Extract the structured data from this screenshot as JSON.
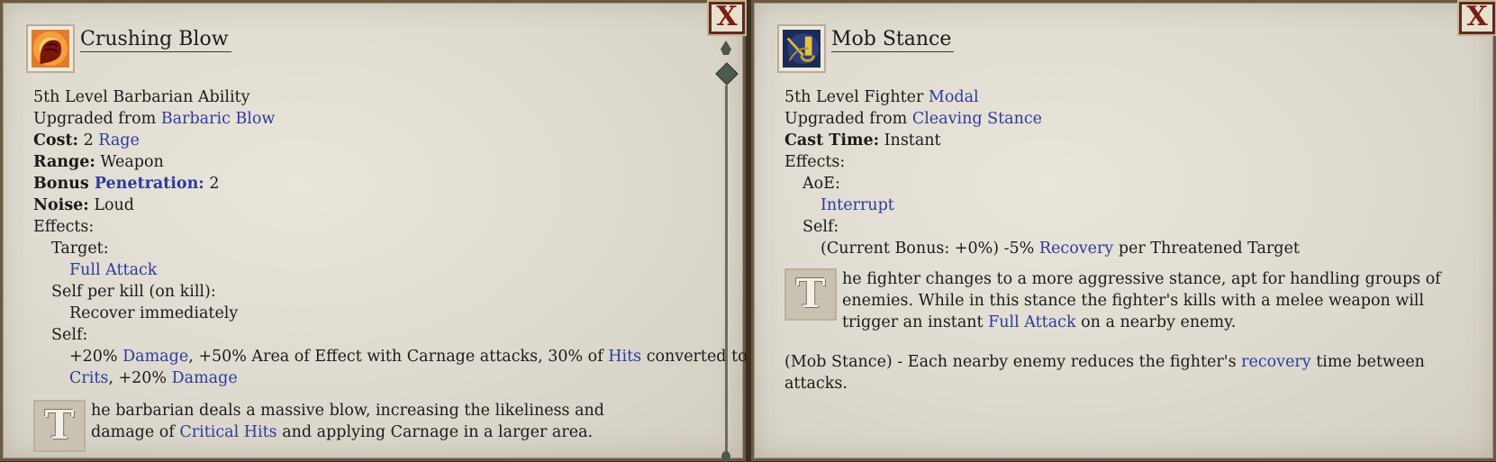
{
  "left": {
    "title": "Crushing Blow",
    "icon": "fist-icon",
    "level_line": "5th Level Barbarian Ability",
    "upgraded_prefix": "Upgraded from ",
    "upgraded_link": "Barbaric Blow",
    "cost_label": "Cost:",
    "cost_value": " 2 ",
    "cost_link": "Rage",
    "range_label": "Range:",
    "range_value": " Weapon",
    "bonus_label": "Bonus ",
    "bonus_link": "Penetration:",
    "bonus_value": " 2",
    "noise_label": "Noise:",
    "noise_value": " Loud",
    "effects_label": "Effects:",
    "target_label": "Target:",
    "target_link": "Full Attack",
    "selfkill_label": "Self per kill (on kill):",
    "selfkill_value": "Recover immediately",
    "self_label": "Self:",
    "self_t1": "+20% ",
    "self_l1": "Damage",
    "self_t2": ", +50% Area of Effect with Carnage attacks, 30% of ",
    "self_l2": "Hits",
    "self_t3": " converted to",
    "self_l3": "Crits",
    "self_t4": ", +20% ",
    "self_l4": "Damage",
    "dropcap": "T",
    "desc_t1": "he barbarian deals a massive blow, increasing the likeliness and damage of ",
    "desc_l1": "Critical Hits",
    "desc_t2": " and applying Carnage in a larger area."
  },
  "right": {
    "title": "Mob Stance",
    "icon": "sword-stance-icon",
    "level_prefix": "5th Level Fighter ",
    "level_link": "Modal",
    "upgraded_prefix": "Upgraded from ",
    "upgraded_link": "Cleaving Stance",
    "cast_label": "Cast Time:",
    "cast_value": " Instant",
    "effects_label": "Effects:",
    "aoe_label": "AoE:",
    "aoe_link": "Interrupt",
    "self_label": "Self:",
    "self_t1": "(Current Bonus: +0%) -5% ",
    "self_l1": "Recovery",
    "self_t2": " per Threatened Target",
    "dropcap": "T",
    "desc_t1": "he fighter changes to a more aggressive stance, apt for handling groups of enemies. While in this stance the fighter's kills with a melee weapon will trigger an instant ",
    "desc_l1": "Full Attack",
    "desc_t2": " on a nearby enemy.",
    "para_t1": "(Mob Stance) - Each nearby enemy reduces the fighter's ",
    "para_l1": "recovery",
    "para_t2": " time between attacks."
  },
  "close_label": "X",
  "colors": {
    "link": "#2e3a9a",
    "parchment": "#e3dfd5",
    "frame": "#6a5a44",
    "close": "#7a1d14"
  }
}
